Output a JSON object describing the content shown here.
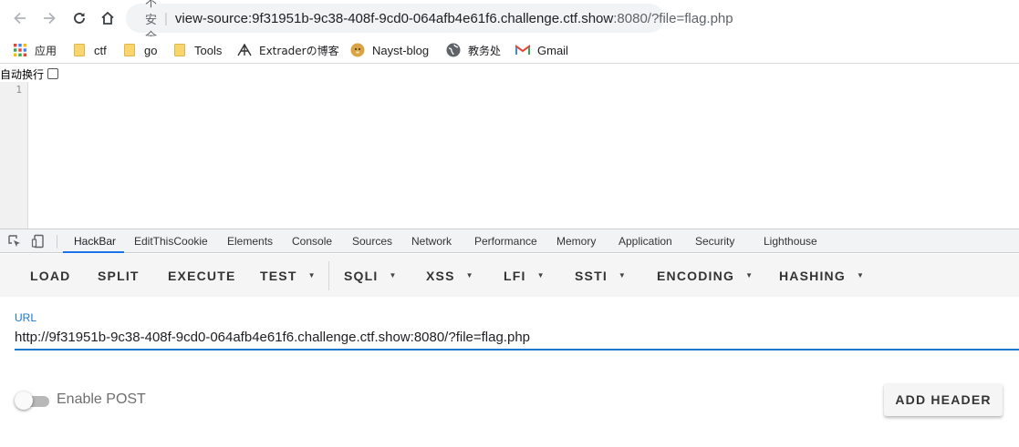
{
  "address_bar": {
    "security_label": "不安全",
    "url_main": "view-source:9f31951b-9c38-408f-9cd0-064afb4e61f6.challenge.ctf.show",
    "url_port_query": ":8080/?file=flag.php"
  },
  "bookmarks": [
    {
      "label": "应用",
      "icon": "apps-grid-icon"
    },
    {
      "label": "ctf",
      "icon": "folder-icon"
    },
    {
      "label": "go",
      "icon": "folder-icon"
    },
    {
      "label": "Tools",
      "icon": "folder-icon"
    },
    {
      "label": "Extraderの博客",
      "icon": "extrader-logo-icon"
    },
    {
      "label": "Nayst-blog",
      "icon": "doge-icon"
    },
    {
      "label": "教务处",
      "icon": "globe-icon"
    },
    {
      "label": "Gmail",
      "icon": "gmail-icon"
    }
  ],
  "view_source": {
    "wrap_label": "自动换行",
    "line_numbers": [
      "1"
    ]
  },
  "devtools": {
    "tabs": [
      "HackBar",
      "EditThisCookie",
      "Elements",
      "Console",
      "Sources",
      "Network",
      "Performance",
      "Memory",
      "Application",
      "Security",
      "Lighthouse"
    ],
    "active_tab": "HackBar"
  },
  "hackbar": {
    "buttons": [
      {
        "label": "LOAD",
        "dropdown": false
      },
      {
        "label": "SPLIT",
        "dropdown": false
      },
      {
        "label": "EXECUTE",
        "dropdown": false
      },
      {
        "label": "TEST",
        "dropdown": true
      },
      {
        "label": "SQLI",
        "dropdown": true
      },
      {
        "label": "XSS",
        "dropdown": true
      },
      {
        "label": "LFI",
        "dropdown": true
      },
      {
        "label": "SSTI",
        "dropdown": true
      },
      {
        "label": "ENCODING",
        "dropdown": true
      },
      {
        "label": "HASHING",
        "dropdown": true
      }
    ],
    "url_label": "URL",
    "url_value": "http://9f31951b-9c38-408f-9cd0-064afb4e61f6.challenge.ctf.show:8080/?file=flag.php",
    "enable_post_label": "Enable POST",
    "enable_post": false,
    "add_header_label": "ADD HEADER"
  },
  "colors": {
    "accent": "#1976d2",
    "devtools_active": "#1a73e8",
    "folder": "#f9d56e",
    "gmail_red": "#ea4335"
  }
}
